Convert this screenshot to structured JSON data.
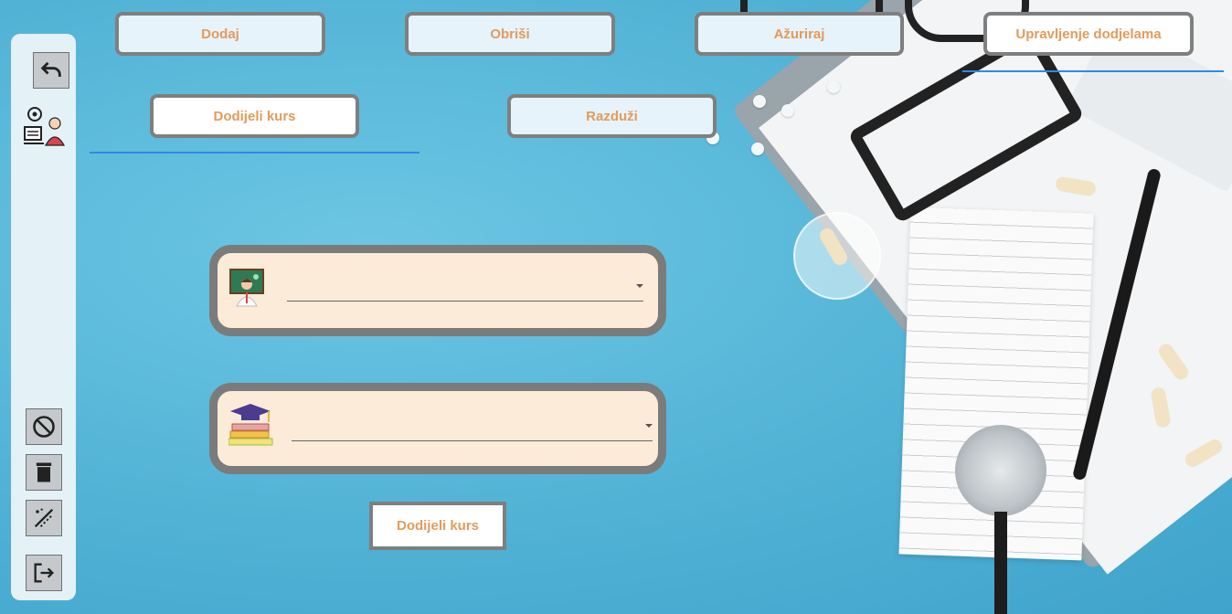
{
  "top_nav": {
    "add_label": "Dodaj",
    "delete_label": "Obriši",
    "update_label": "Ažuriraj",
    "manage_label": "Upravljenje dodjelama"
  },
  "sub_nav": {
    "assign_label": "Dodijeli kurs",
    "unassign_label": "Razduži"
  },
  "form": {
    "teacher_select": {
      "value": ""
    },
    "course_select": {
      "value": ""
    },
    "submit_label": "Dodijeli kurs"
  },
  "sidebar": {
    "icons": [
      "undo-icon",
      "admin-user-icon",
      "cancel-icon",
      "trash-icon",
      "clear-edit-icon",
      "logout-icon"
    ]
  },
  "colors": {
    "accent_text": "#e39b5b",
    "underline": "#2f8ae4",
    "panel_bg": "#fbebd8",
    "border": "#7f7f7f"
  }
}
